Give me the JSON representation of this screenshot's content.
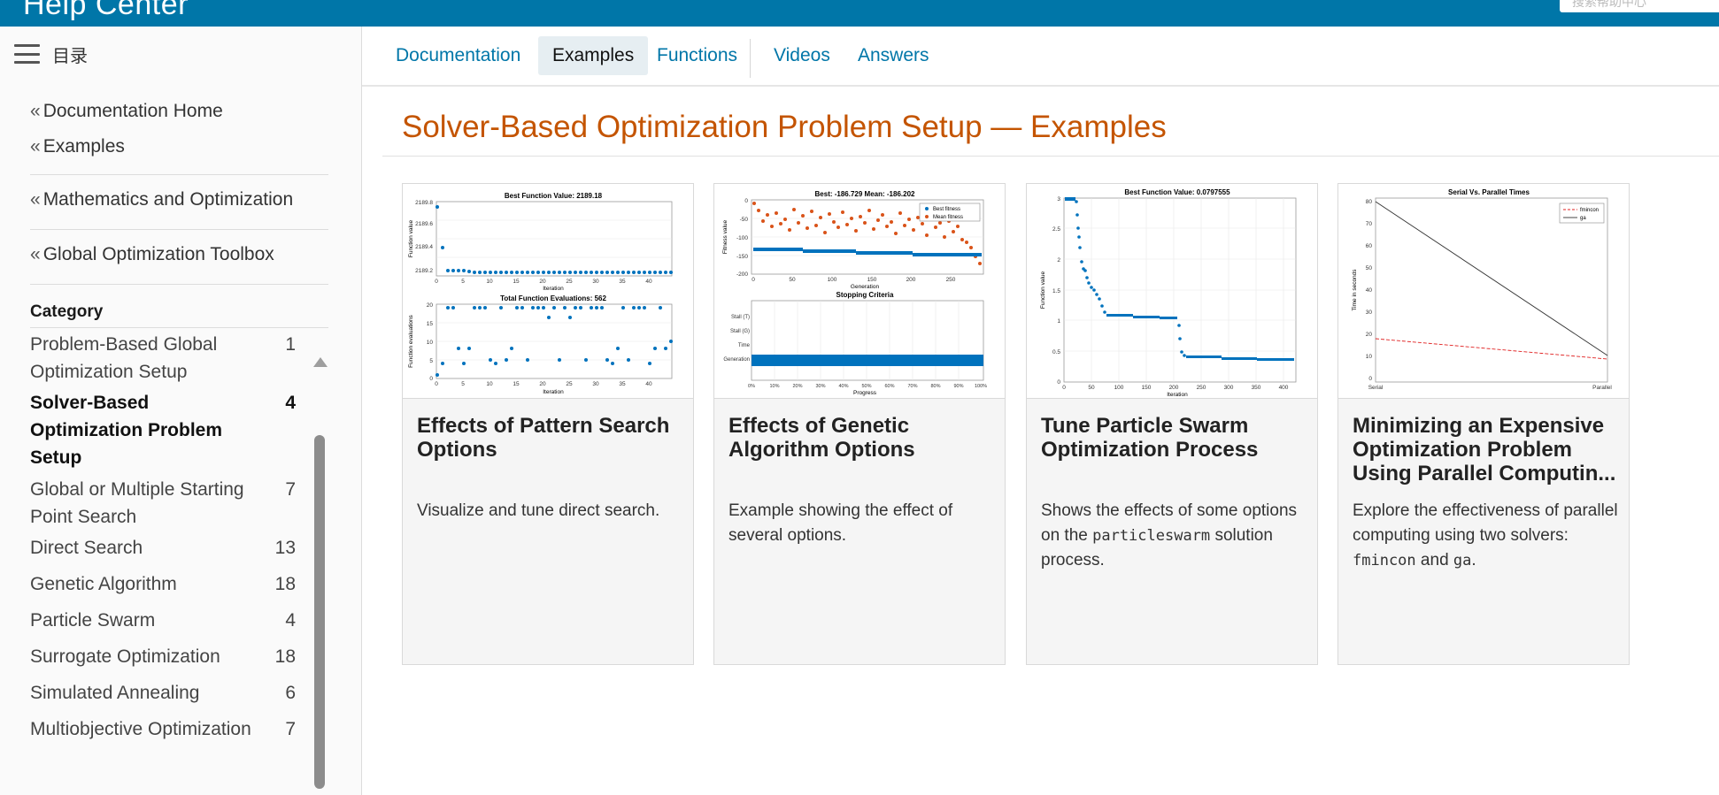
{
  "header": {
    "title": "Help Center",
    "search_placeholder": "搜索帮助中心"
  },
  "sidebar": {
    "toc_label": "目录",
    "nav_links": [
      {
        "label": "Documentation Home"
      },
      {
        "label": "Examples"
      },
      {
        "label": "Mathematics and Optimization"
      },
      {
        "label": "Global Optimization Toolbox"
      }
    ],
    "category_title": "Category",
    "categories": [
      {
        "name": "Problem-Based Global Optimization Setup",
        "count": "1"
      },
      {
        "name": "Solver-Based Optimization Problem Setup",
        "count": "4",
        "active": true
      },
      {
        "name": "Global or Multiple Starting Point Search",
        "count": "7"
      },
      {
        "name": "Direct Search",
        "count": "13"
      },
      {
        "name": "Genetic Algorithm",
        "count": "18"
      },
      {
        "name": "Particle Swarm",
        "count": "4"
      },
      {
        "name": "Surrogate Optimization",
        "count": "18"
      },
      {
        "name": "Simulated Annealing",
        "count": "6"
      },
      {
        "name": "Multiobjective Optimization",
        "count": "7"
      }
    ]
  },
  "tabs": [
    {
      "label": "Documentation"
    },
    {
      "label": "Examples",
      "active": true
    },
    {
      "label": "Functions"
    },
    {
      "label": "Videos"
    },
    {
      "label": "Answers"
    }
  ],
  "page_title": "Solver-Based Optimization Problem Setup — Examples",
  "cards": [
    {
      "title": "Effects of Pattern Search Options",
      "desc": "Visualize and tune direct search.",
      "thumb": {
        "top_title": "Best Function Value: 2189.18",
        "top_ylabel": "Function value",
        "top_yticks": [
          "2189.8",
          "2189.6",
          "2189.4",
          "2189.2"
        ],
        "bottom_title": "Total Function Evaluations: 562",
        "bottom_ylabel": "Function evaluations",
        "bottom_yticks": [
          "20",
          "15",
          "10",
          "5",
          "0"
        ],
        "xlabel": "Iteration",
        "xticks": [
          "0",
          "5",
          "10",
          "15",
          "20",
          "25",
          "30",
          "35",
          "40"
        ]
      }
    },
    {
      "title": "Effects of Genetic Algorithm Options",
      "desc": "Example showing the effect of several options.",
      "thumb": {
        "top_title": "Best: -186.729 Mean: -186.202",
        "top_ylabel": "Fitness value",
        "top_yticks": [
          "0",
          "-50",
          "-100",
          "-150",
          "-200"
        ],
        "top_xlabel": "Generation",
        "top_xticks": [
          "0",
          "50",
          "100",
          "150",
          "200",
          "250"
        ],
        "legend": [
          "Best fitness",
          "Mean fitness"
        ],
        "bottom_title": "Stopping Criteria",
        "bottom_rows": [
          "Stall (T)",
          "Stall (G)",
          "Time",
          "Generation"
        ],
        "bottom_xlabel": "Progress",
        "bottom_xticks": [
          "0%",
          "10%",
          "20%",
          "30%",
          "40%",
          "50%",
          "60%",
          "70%",
          "80%",
          "90%",
          "100%"
        ]
      }
    },
    {
      "title": "Tune Particle Swarm Optimization Process",
      "desc_before": "Shows the effects of some options on the ",
      "desc_code": "particleswarm",
      "desc_after": " solution process.",
      "thumb": {
        "title": "Best Function Value: 0.0797555",
        "ylabel": "Function value",
        "yticks": [
          "3",
          "2.5",
          "2",
          "1.5",
          "1",
          "0.5",
          "0"
        ],
        "xlabel": "Iteration",
        "xticks": [
          "0",
          "50",
          "100",
          "150",
          "200",
          "250",
          "300",
          "350",
          "400"
        ]
      }
    },
    {
      "title": "Minimizing an Expensive Optimization Problem Using Parallel Computin...",
      "desc_before": "Explore the effectiveness of parallel computing using two solvers: ",
      "desc_code": "fmincon",
      "desc_mid": " and ",
      "desc_code2": "ga",
      "desc_after": ".",
      "thumb": {
        "title": "Serial Vs. Parallel Times",
        "ylabel": "Time in seconds",
        "yticks": [
          "80",
          "70",
          "60",
          "50",
          "40",
          "30",
          "20",
          "10",
          "0"
        ],
        "xticks": [
          "Serial",
          "Parallel"
        ],
        "legend": [
          "fmincon",
          "ga"
        ]
      }
    }
  ],
  "colors": {
    "accent": "#0076a8",
    "title_orange": "#c45400",
    "blue_dots": "#0072bd",
    "orange_dots": "#d95319"
  }
}
